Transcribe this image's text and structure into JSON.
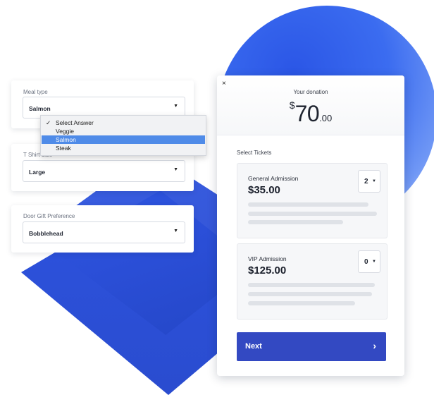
{
  "form": {
    "meal": {
      "label": "Meal type",
      "value": "Salmon"
    },
    "meal_dropdown": {
      "options": [
        "Select Answer",
        "Veggie",
        "Salmon",
        "Steak"
      ],
      "checked_index": 0,
      "highlighted_index": 2
    },
    "shirt": {
      "label": "T Shirt Size",
      "value": "Large"
    },
    "gift": {
      "label": "Door Gift Preference",
      "value": "Bobblehead"
    }
  },
  "donation": {
    "close_label": "×",
    "label": "Your donation",
    "currency": "$",
    "amount": "70",
    "cents": ".00"
  },
  "tickets": {
    "title": "Select Tickets",
    "items": [
      {
        "name": "General Admission",
        "price": "$35.00",
        "quantity": "2"
      },
      {
        "name": "VIP Admission",
        "price": "$125.00",
        "quantity": "0"
      }
    ]
  },
  "next_button": {
    "label": "Next",
    "arrow": "›"
  },
  "icons": {
    "caret": "▼",
    "small_caret": "▼",
    "check": "✓"
  },
  "colors": {
    "accent": "#3349c2",
    "highlight": "#4f8be8",
    "deco_blue": "#2b4fd8"
  }
}
